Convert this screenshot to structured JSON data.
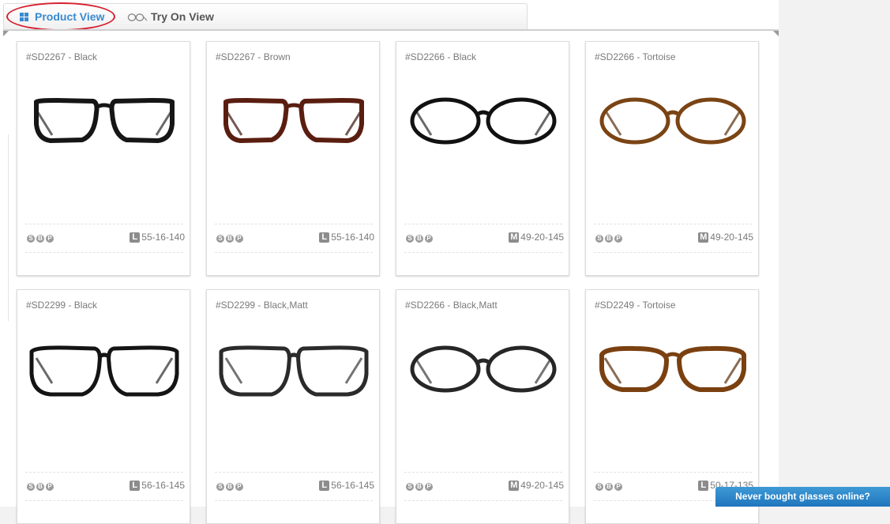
{
  "tabs": {
    "product_view": "Product View",
    "try_on_view": "Try On View"
  },
  "colors": {
    "accent": "#3a8ad0",
    "highlight_oval": "#d62030",
    "cta_bg": "#2a86cc"
  },
  "products": [
    {
      "title": "#SD2267 - Black",
      "badges": [
        "S",
        "B",
        "P"
      ],
      "size_code": "L",
      "size": "55-16-140",
      "frame_color": "#161616",
      "frame_shape": "rect",
      "temple_color": "#2a2a2a"
    },
    {
      "title": "#SD2267 - Brown",
      "badges": [
        "S",
        "B",
        "P"
      ],
      "size_code": "L",
      "size": "55-16-140",
      "frame_color": "#5a1e10",
      "frame_shape": "rect",
      "temple_color": "#3a140a"
    },
    {
      "title": "#SD2266 - Black",
      "badges": [
        "S",
        "B",
        "P"
      ],
      "size_code": "M",
      "size": "49-20-145",
      "frame_color": "#111111",
      "frame_shape": "oval",
      "temple_color": "#2a2a2a"
    },
    {
      "title": "#SD2266 - Tortoise",
      "badges": [
        "S",
        "B",
        "P"
      ],
      "size_code": "M",
      "size": "49-20-145",
      "frame_color": "#7a4414",
      "frame_shape": "oval",
      "temple_color": "#5a2e0c"
    },
    {
      "title": "#SD2299 - Black",
      "badges": [
        "S",
        "B",
        "P"
      ],
      "size_code": "L",
      "size": "56-16-145",
      "frame_color": "#141414",
      "frame_shape": "square",
      "temple_color": "#2a2a2a"
    },
    {
      "title": "#SD2299 - Black,Matt",
      "badges": [
        "S",
        "B",
        "P"
      ],
      "size_code": "L",
      "size": "56-16-145",
      "frame_color": "#2b2b2b",
      "frame_shape": "square",
      "temple_color": "#3a3a3a"
    },
    {
      "title": "#SD2266 - Black,Matt",
      "badges": [
        "S",
        "B",
        "P"
      ],
      "size_code": "M",
      "size": "49-20-145",
      "frame_color": "#262626",
      "frame_shape": "oval",
      "temple_color": "#3a3a3a"
    },
    {
      "title": "#SD2249 - Tortoise",
      "badges": [
        "S",
        "B",
        "P"
      ],
      "size_code": "L",
      "size": "50-17-135",
      "frame_color": "#7a4010",
      "frame_shape": "cat",
      "temple_color": "#5a2e0c"
    }
  ],
  "cta": {
    "label": "Never bought glasses online?"
  }
}
